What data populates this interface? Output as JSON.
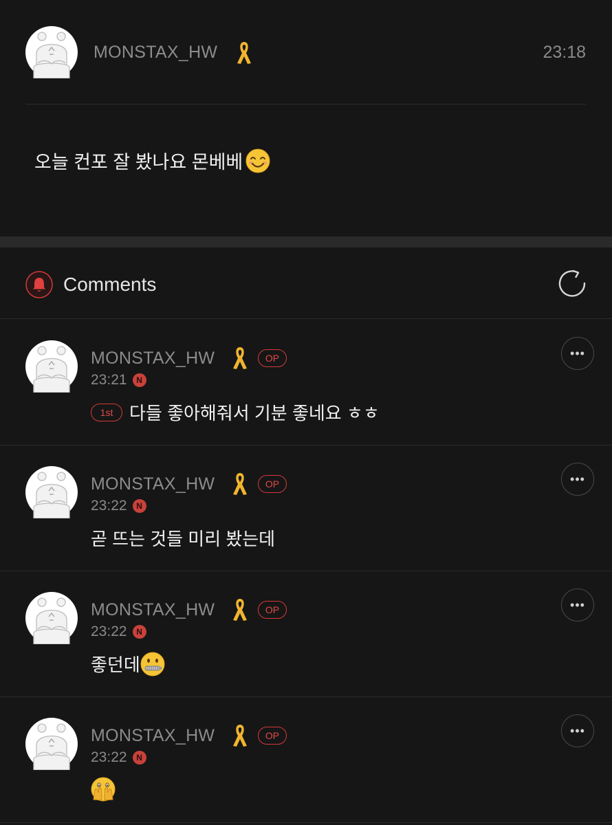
{
  "post": {
    "author": "MONSTAX_HW",
    "time": "23:18",
    "body": "오늘 컨포 잘 봤나요 몬베베",
    "emoji": "smiling-face-icon"
  },
  "comments_section": {
    "title": "Comments",
    "accent_color": "#d43a3a"
  },
  "comments": [
    {
      "author": "MONSTAX_HW",
      "badge": "OP",
      "time": "23:21",
      "new_badge": "N",
      "rank_badge": "1st",
      "text": "다들 좋아해줘서 기분 좋네요 ㅎㅎ",
      "more": "•••"
    },
    {
      "author": "MONSTAX_HW",
      "badge": "OP",
      "time": "23:22",
      "new_badge": "N",
      "text": "곧 뜨는 것들 미리 봤는데",
      "more": "•••"
    },
    {
      "author": "MONSTAX_HW",
      "badge": "OP",
      "time": "23:22",
      "new_badge": "N",
      "text": "좋던데",
      "emoji": "zipper-mouth-face-icon",
      "more": "•••"
    },
    {
      "author": "MONSTAX_HW",
      "badge": "OP",
      "time": "23:22",
      "new_badge": "N",
      "text": "",
      "emoji": "face-with-hands-over-mouth-icon",
      "more": "•••"
    }
  ]
}
